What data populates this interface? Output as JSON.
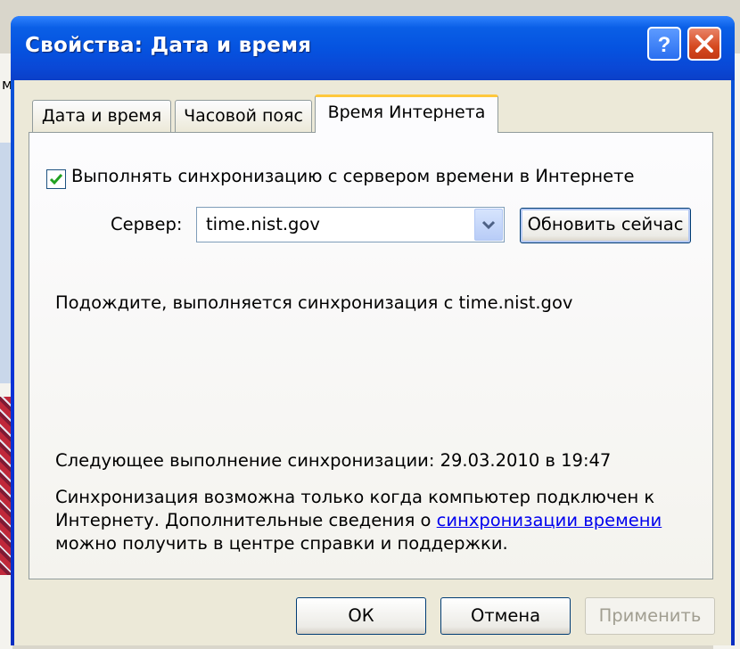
{
  "window": {
    "title": "Свойства: Дата и время"
  },
  "tabs": [
    {
      "label": "Дата и время",
      "active": false
    },
    {
      "label": "Часовой пояс",
      "active": false
    },
    {
      "label": "Время Интернета",
      "active": true
    }
  ],
  "sync": {
    "checkbox_label": "Выполнять синхронизацию с сервером времени в Интернете",
    "checked": true,
    "server_label": "Сервер:",
    "server_value": "time.nist.gov",
    "update_button": "Обновить сейчас",
    "status": "Подождите, выполняется синхронизация с time.nist.gov",
    "next_sync": "Следующее выполнение синхронизации: 29.03.2010 в 19:47",
    "info_line1": "Синхронизация возможна только когда компьютер подключен к",
    "info_line2_before": "Интернету. Дополнительные сведения о ",
    "info_link": "синхронизации времени",
    "info_line3": "можно получить в центре справки и поддержки."
  },
  "buttons": {
    "ok": "ОК",
    "cancel": "Отмена",
    "apply": "Применить"
  },
  "background": {
    "left_fragment": "м"
  },
  "icons": {
    "help": "help-icon",
    "close": "close-icon",
    "check": "check-icon",
    "dropdown": "chevron-down-icon"
  },
  "colors": {
    "title_bar": "#0553e0",
    "active_tab_accent": "#ffc83c",
    "link": "#0000ee",
    "close_button": "#d5491f"
  }
}
